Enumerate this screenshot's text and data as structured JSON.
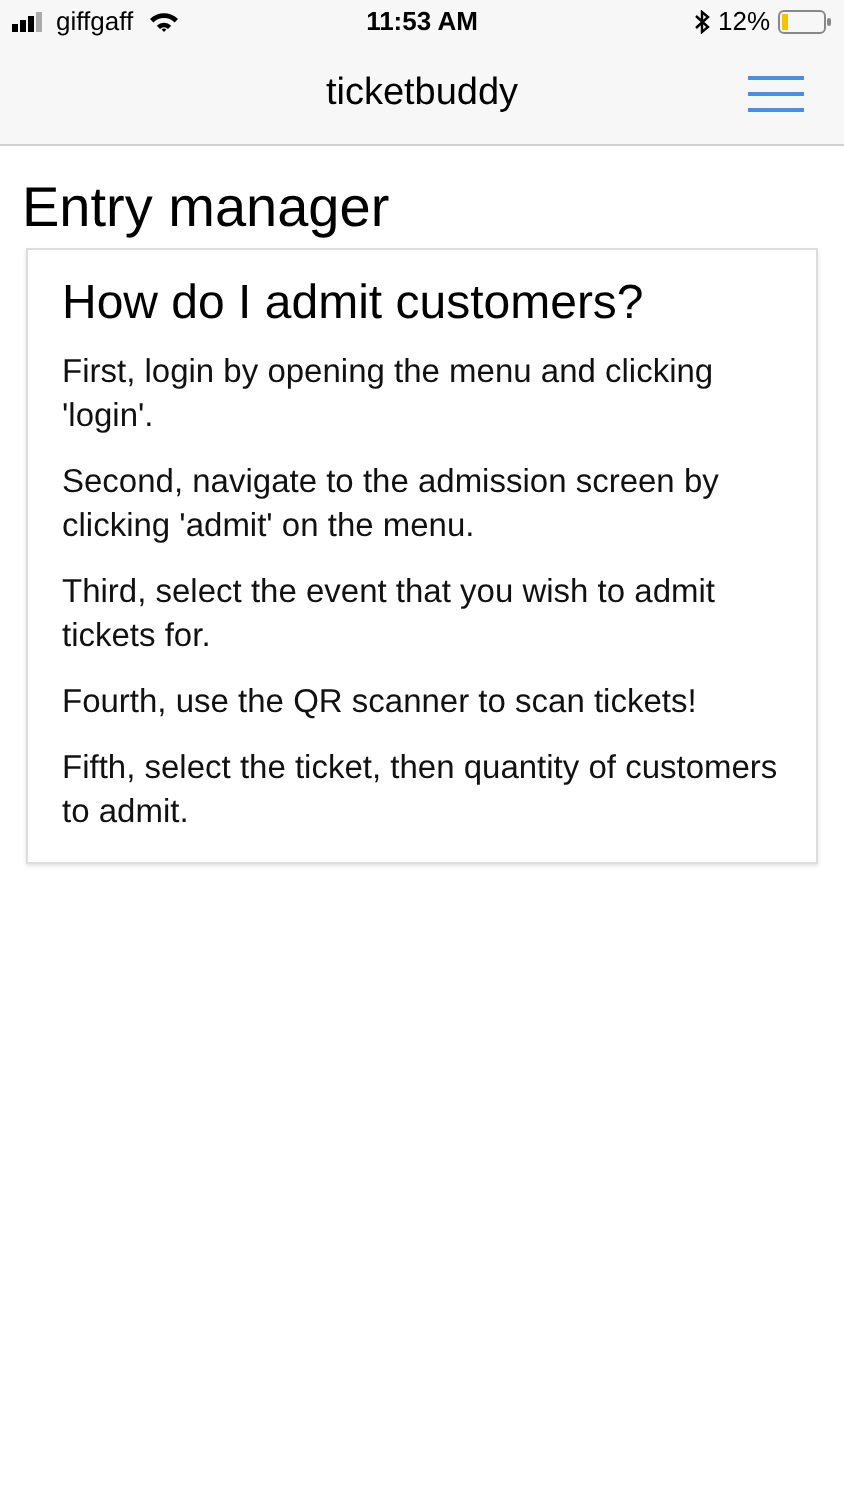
{
  "status_bar": {
    "carrier": "giffgaff",
    "time": "11:53 AM",
    "battery": "12%"
  },
  "nav_bar": {
    "title": "ticketbuddy"
  },
  "page": {
    "title": "Entry manager"
  },
  "card": {
    "title": "How do I admit customers?",
    "paragraphs": [
      "First, login by opening the menu and clicking 'login'.",
      "Second, navigate to the admission screen by clicking 'admit' on the menu.",
      "Third, select the event that you wish to admit tickets for.",
      "Fourth, use the QR scanner to scan tickets!",
      "Fifth, select the ticket, then quantity of customers to admit."
    ]
  }
}
